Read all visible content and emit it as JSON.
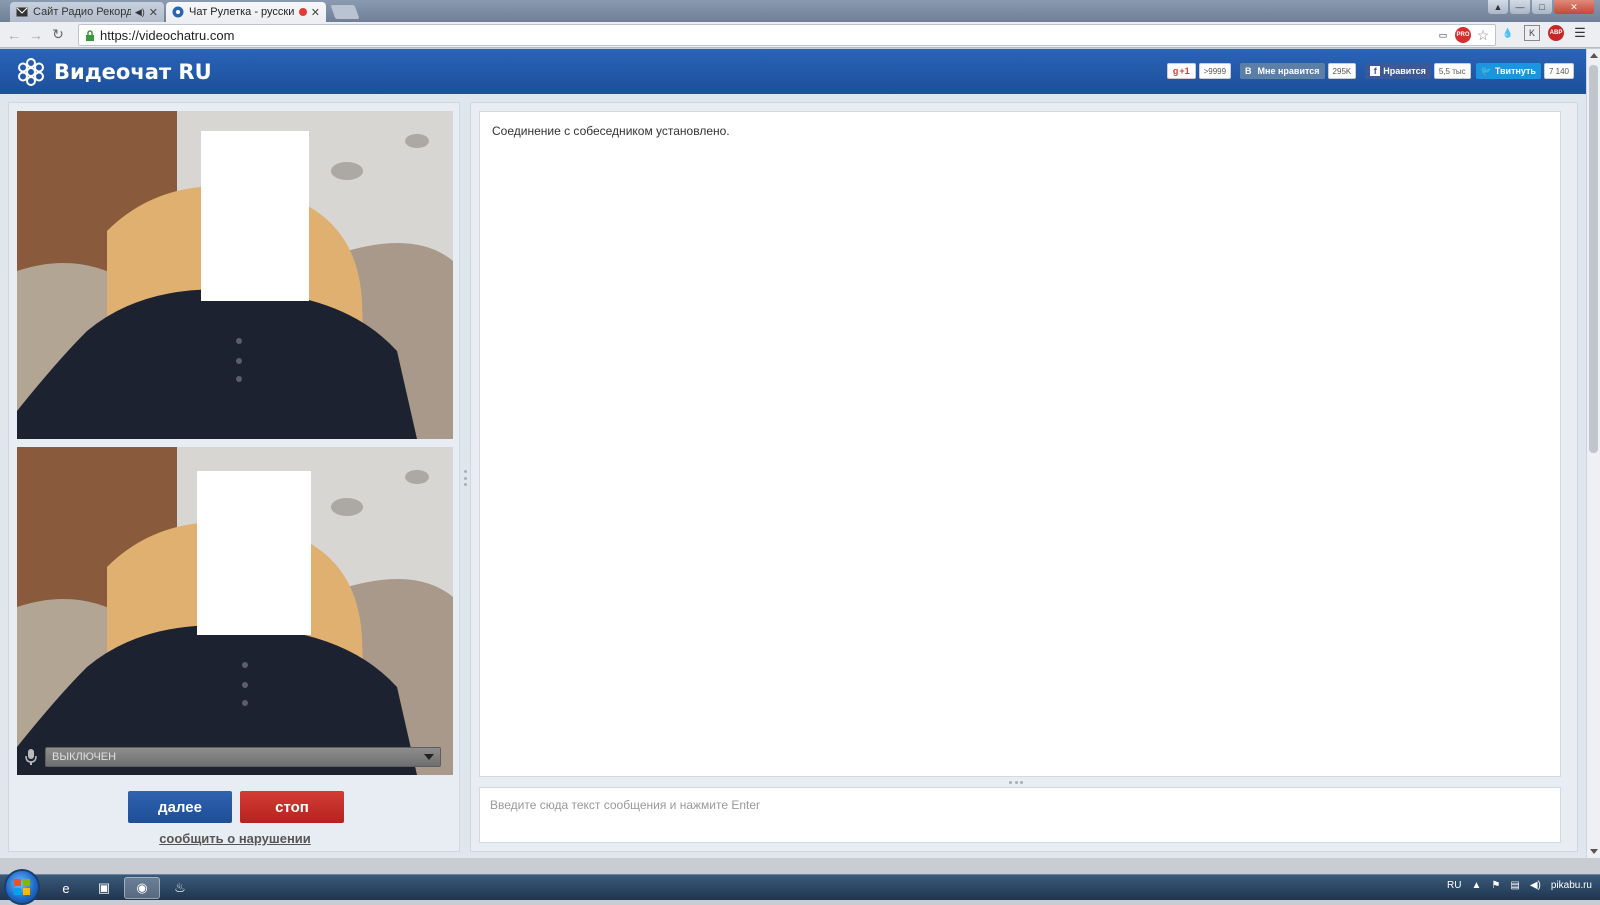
{
  "browser": {
    "tabs": [
      {
        "title": "Сайт Радио Рекорд",
        "active": false
      },
      {
        "title": "Чат Рулетка - русский",
        "active": true
      }
    ],
    "url": "https://videochatru.com"
  },
  "site": {
    "logo_text": "Видеочат RU",
    "social": {
      "gplus_label": "+1",
      "gplus_count": ">9999",
      "vk_label": "В",
      "vk_like": "Мне нравится",
      "vk_count": "295K",
      "fb_label": "Нравится",
      "fb_count": "5,5 тыс",
      "tw_label": "Твитнуть",
      "tw_count": "7 140"
    }
  },
  "video": {
    "mic_status": "ВЫКЛЮЧЕН"
  },
  "controls": {
    "next_label": "далее",
    "stop_label": "стоп",
    "report_label": "сообщить о нарушении"
  },
  "chat": {
    "messages": [
      "Соединение с собеседником установлено."
    ],
    "input_placeholder": "Введите сюда текст сообщения и нажмите Enter"
  },
  "taskbar": {
    "lang": "RU",
    "watermark": "pikabu.ru"
  },
  "colors": {
    "brand_blue": "#1f4e96",
    "stop_red": "#b6231f"
  }
}
